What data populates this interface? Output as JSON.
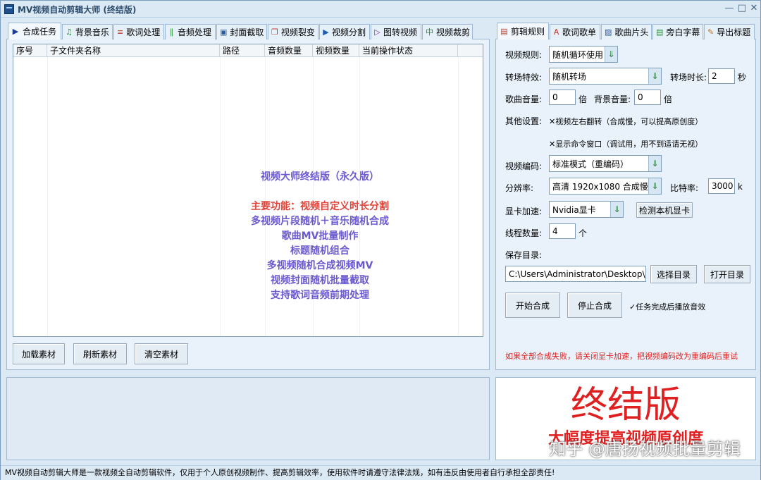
{
  "window": {
    "title": "MV视频自动剪辑大师 (终结版)",
    "min": "—",
    "max": "□",
    "close": "✕"
  },
  "left_tabs": [
    {
      "label": "合成任务",
      "icon": "play-icon",
      "glyph": "▶",
      "color": "#1f3f8f"
    },
    {
      "label": "背景音乐",
      "icon": "music-note-icon",
      "glyph": "♫",
      "color": "#2a8a3a"
    },
    {
      "label": "歌词处理",
      "icon": "lyrics-icon",
      "glyph": "≡",
      "color": "#c0392b"
    },
    {
      "label": "音频处理",
      "icon": "audio-wave-icon",
      "glyph": "∥",
      "color": "#2a8a3a"
    },
    {
      "label": "封面截取",
      "icon": "image-icon",
      "glyph": "▣",
      "color": "#2a5aa0"
    },
    {
      "label": "视频裂变",
      "icon": "split-icon",
      "glyph": "❐",
      "color": "#c0392b"
    },
    {
      "label": "视频分割",
      "icon": "film-icon",
      "glyph": "▶",
      "color": "#1f5fb0"
    },
    {
      "label": "图转视频",
      "icon": "slideshow-icon",
      "glyph": "▷",
      "color": "#7a2aa0"
    },
    {
      "label": "视频裁剪",
      "icon": "crop-icon",
      "glyph": "中",
      "color": "#2a8a3a"
    }
  ],
  "right_tabs": [
    {
      "label": "剪辑规则",
      "icon": "rules-icon",
      "glyph": "▤",
      "color": "#c0392b"
    },
    {
      "label": "歌词歌单",
      "icon": "font-icon",
      "glyph": "A",
      "color": "#c0392b"
    },
    {
      "label": "歌曲片头",
      "icon": "picture-icon",
      "glyph": "▨",
      "color": "#2a5aa0"
    },
    {
      "label": "旁白字幕",
      "icon": "document-icon",
      "glyph": "▤",
      "color": "#2a8a3a"
    },
    {
      "label": "导出标题",
      "icon": "edit-icon",
      "glyph": "✎",
      "color": "#c07020"
    }
  ],
  "table": {
    "columns": [
      "序号",
      "子文件夹名称",
      "路径",
      "音频数量",
      "视频数量",
      "当前操作状态"
    ]
  },
  "promo": {
    "title": "视频大师终结版（永久版）",
    "main": "主要功能：视频自定义时长分割",
    "features": [
      "多视频片段随机＋音乐随机合成",
      "歌曲MV批量制作",
      "标题随机组合",
      "多视频随机合成视频MV",
      "视频封面随机批量截取",
      "支持歌词音频前期处理"
    ]
  },
  "left_buttons": {
    "load": "加载素材",
    "refresh": "刷新素材",
    "clear": "清空素材"
  },
  "rules": {
    "video_rule_label": "视频规则:",
    "video_rule_value": "随机循环使用",
    "transition_label": "转场特效:",
    "transition_value": "随机转场",
    "transition_dur_label": "转场时长:",
    "transition_dur_value": "2",
    "transition_dur_unit": "秒",
    "song_vol_label": "歌曲音量:",
    "song_vol_value": "0",
    "song_vol_unit": "倍",
    "bg_vol_label": "背景音量:",
    "bg_vol_value": "0",
    "bg_vol_unit": "倍",
    "other_label": "其他设置:",
    "flip_check": "✕视频左右翻转（合成慢，可以提高原创度）",
    "cmd_check": "✕显示命令窗口（调试用，用不到适请无视）",
    "codec_label": "视频编码:",
    "codec_value": "标准模式（重编码）",
    "res_label": "分辨率:",
    "res_value": "高清 1920x1080 合成慢",
    "bitrate_label": "比特率:",
    "bitrate_value": "3000",
    "bitrate_unit": "k",
    "gpu_label": "显卡加速:",
    "gpu_value": "Nvidia显卡",
    "gpu_detect": "检测本机显卡",
    "threads_label": "线程数量:",
    "threads_value": "4",
    "threads_unit": "个",
    "save_label": "保存目录:",
    "save_path": "C:\\Users\\Administrator\\Desktop\\分割",
    "choose_dir": "选择目录",
    "open_dir": "打开目录",
    "start": "开始合成",
    "stop": "停止合成",
    "play_check": "✓任务完成后播放音效",
    "warning": "如果全部合成失败，请关闭显卡加速，把视频编码改为重编码后重试"
  },
  "banner": {
    "title": "终结版",
    "subtitle": "大幅度提高视频原创度"
  },
  "watermark": "知乎 @唐扬视频批量剪辑",
  "status": "MV视频自动剪辑大师是一款视频全自动剪辑软件，仅用于个人原创视频制作、提高剪辑效率，使用软件时请遵守法律法规，如有违反由使用者自行承担全部责任!",
  "colors": {
    "promo_blue": "#6a5ad0",
    "promo_red": "#e0443a",
    "warning_red": "#e02020"
  }
}
